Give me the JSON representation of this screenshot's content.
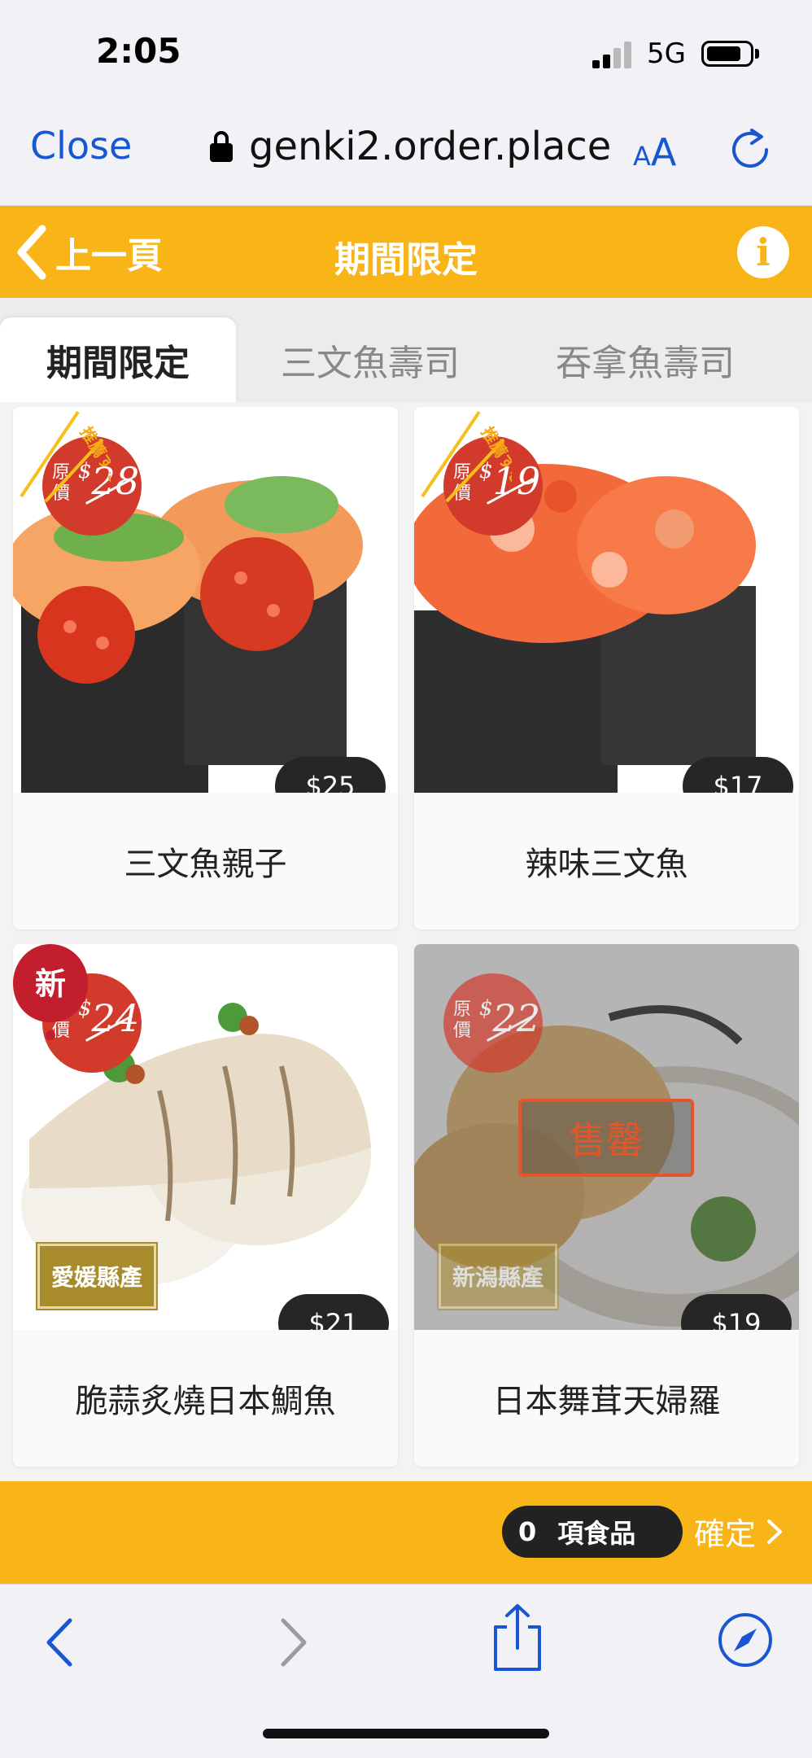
{
  "status_bar": {
    "time": "2:05",
    "network": "5G"
  },
  "browser": {
    "close_label": "Close",
    "url": "genki2.order.place",
    "text_size_small": "A",
    "text_size_big": "A"
  },
  "header": {
    "back_label": "上一頁",
    "title": "期間限定",
    "info_label": "i"
  },
  "tabs": [
    {
      "label": "期間限定",
      "active": true
    },
    {
      "label": "三文魚壽司",
      "active": false
    },
    {
      "label": "吞拿魚壽司",
      "active": false
    }
  ],
  "items": [
    {
      "name": "三文魚親子",
      "price": "$25",
      "orig_label": "原價",
      "orig_price": "28",
      "recommend": "推薦する！"
    },
    {
      "name": "辣味三文魚",
      "price": "$17",
      "orig_label": "原價",
      "orig_price": "19",
      "recommend": "推薦する！"
    },
    {
      "name": "脆蒜炙燒日本鯛魚",
      "price": "$21",
      "orig_label": "原價",
      "orig_price": "24",
      "new_badge": "新",
      "origin_tag": "愛媛縣產"
    },
    {
      "name": "日本舞茸天婦羅",
      "price": "$19",
      "orig_label": "原價",
      "orig_price": "22",
      "origin_tag": "新潟縣產",
      "sold_out": "售罄"
    }
  ],
  "cart": {
    "count": "0",
    "items_label": "項食品",
    "confirm_label": "確定"
  },
  "colors": {
    "brand_yellow": "#f9b518",
    "link_blue": "#1957d2",
    "badge_red": "#d23a2b",
    "soldout_orange": "#e4552a"
  }
}
